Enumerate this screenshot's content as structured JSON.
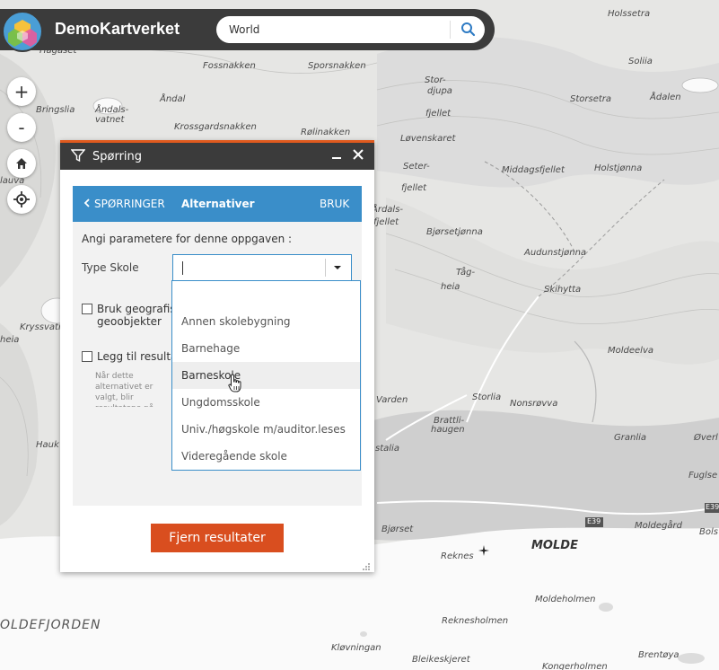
{
  "app": {
    "title": "DemoKartverket",
    "brand_color": "#4a9ed6",
    "bar_color": "#3b3b3b"
  },
  "search": {
    "value": "World",
    "icon": "search-icon"
  },
  "map_controls": [
    {
      "label": "+",
      "name": "zoom-in-button"
    },
    {
      "label": "-",
      "name": "zoom-out-button"
    },
    {
      "icon": "home-icon",
      "name": "home-button"
    },
    {
      "icon": "locate-icon",
      "name": "locate-button"
    }
  ],
  "map_labels": {
    "holssetra": "Holssetra",
    "soliia": "Soliia",
    "hagaset": "Hagaset",
    "fossnakken": "Fossnakken",
    "sporsnakken": "Sporsnakken",
    "stor": "Stor-",
    "djupa": "djupa",
    "fjeltet": "fjellet",
    "storsetra": "Storsetra",
    "adalen": "Ådalen",
    "ndal": "Åndal",
    "andalsvatnet": "Åndals-vatnet",
    "bringslia": "Bringslia",
    "krossgardsnakken": "Krossgardsnakken",
    "rolinakken": "Rølinakken",
    "loveskaret": "Løvenskaret",
    "seter": "Seter-",
    "fjellet2": "fjellet",
    "middagsfjellet": "Middagsfjellet",
    "holstjonna": "Holstjønna",
    "ardalsfjellet": "Årdals-",
    "fjellet3": "fjellet",
    "bjorsetjonna": "Bjørsetjønna",
    "audunstjonna": "Audunstjønna",
    "tag": "Tåg-",
    "heia": "heia",
    "skihytta": "Skihytta",
    "moldeelva": "Moldeelva",
    "storlia": "Storlia",
    "varden": "Varden",
    "nonsrovva": "Nonsrøvva",
    "brattli": "Brattli-",
    "haugen": "haugen",
    "granlia": "Granlia",
    "stalia": "stalia",
    "overl": "Øverl",
    "fuglset": "Fuglse",
    "moldegard": "Moldegård",
    "bjorset": "Bjørset",
    "reknes": "Reknes",
    "molde": "MOLDE",
    "bols": "Bols",
    "moldeholmen": "Moldeholmen",
    "reknesholmen": "Reknesholmen",
    "moldefjorden": "OLDEFJORDEN",
    "klovningan": "Kløvningan",
    "bleikeskjeret": "Bleikeskjeret",
    "brentoya": "Brentøya",
    "kongerholmen": "Kongerholmen",
    "krysvatn": "Kryssvatn",
    "heia2": "heia",
    "e39": "E39",
    "e39b": "E39",
    "hauk": "Hauk",
    "lauva": "lauva"
  },
  "panel": {
    "title": "Spørring",
    "accent_color": "#e05a1e",
    "nav": {
      "back": "SPØRRINGER",
      "title": "Alternativer",
      "apply": "BRUK",
      "color": "#3a8ec9"
    },
    "prompt": "Angi parametere for denne oppgaven :",
    "type_label": "Type Skole",
    "checkbox1_line1": "Bruk geografiske",
    "checkbox1_line2": "geoobjekter",
    "checkbox2": "Legg til resultater",
    "note": "Når dette alternativet er valgt, blir resultatene på kartet Fjern resultater.",
    "clear_button": "Fjern resultater"
  },
  "dropdown": {
    "options": [
      "",
      "Annen skolebygning",
      "Barnehage",
      "Barneskole",
      "Ungdomsskole",
      "Univ./høgskole m/auditor.leses",
      "Videregående skole"
    ],
    "hovered": "Barneskole"
  }
}
